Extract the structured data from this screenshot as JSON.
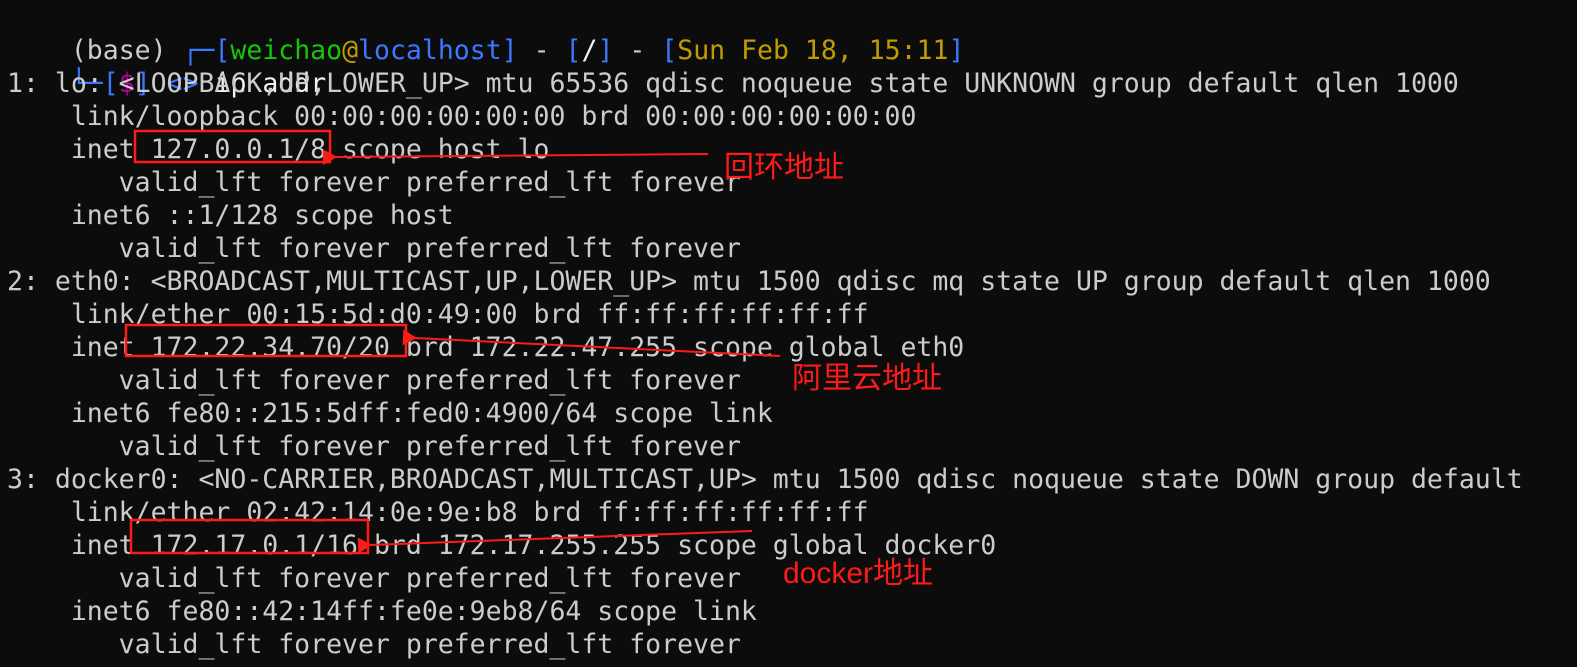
{
  "prompt": {
    "env": "(base) ",
    "corner_top": "┌─",
    "lbracket": "[",
    "user": "weichao",
    "at": "@",
    "host": "localhost",
    "rbracket": "]",
    "dash": " - ",
    "cwd": "/",
    "date": "Sun Feb 18, 15:11",
    "corner_bottom": "└─",
    "dollar": "$",
    "arrows": " <> ",
    "command": "ip addr"
  },
  "output_lines": [
    "1: lo: <LOOPBACK,UP,LOWER_UP> mtu 65536 qdisc noqueue state UNKNOWN group default qlen 1000",
    "    link/loopback 00:00:00:00:00:00 brd 00:00:00:00:00:00",
    "    inet 127.0.0.1/8 scope host lo",
    "       valid_lft forever preferred_lft forever",
    "    inet6 ::1/128 scope host",
    "       valid_lft forever preferred_lft forever",
    "2: eth0: <BROADCAST,MULTICAST,UP,LOWER_UP> mtu 1500 qdisc mq state UP group default qlen 1000",
    "    link/ether 00:15:5d:d0:49:00 brd ff:ff:ff:ff:ff:ff",
    "    inet 172.22.34.70/20 brd 172.22.47.255 scope global eth0",
    "       valid_lft forever preferred_lft forever",
    "    inet6 fe80::215:5dff:fed0:4900/64 scope link",
    "       valid_lft forever preferred_lft forever",
    "3: docker0: <NO-CARRIER,BROADCAST,MULTICAST,UP> mtu 1500 qdisc noqueue state DOWN group default",
    "    link/ether 02:42:14:0e:9e:b8 brd ff:ff:ff:ff:ff:ff",
    "    inet 172.17.0.1/16 brd 172.17.255.255 scope global docker0",
    "       valid_lft forever preferred_lft forever",
    "    inet6 fe80::42:14ff:fe0e:9eb8/64 scope link",
    "       valid_lft forever preferred_lft forever"
  ],
  "annotations": {
    "loopback": "回环地址",
    "aliyun": "阿里云地址",
    "docker": "docker地址"
  },
  "colors": {
    "background": "#0c0c0c",
    "text": "#cccccc",
    "annotation": "#ff1a1a"
  }
}
